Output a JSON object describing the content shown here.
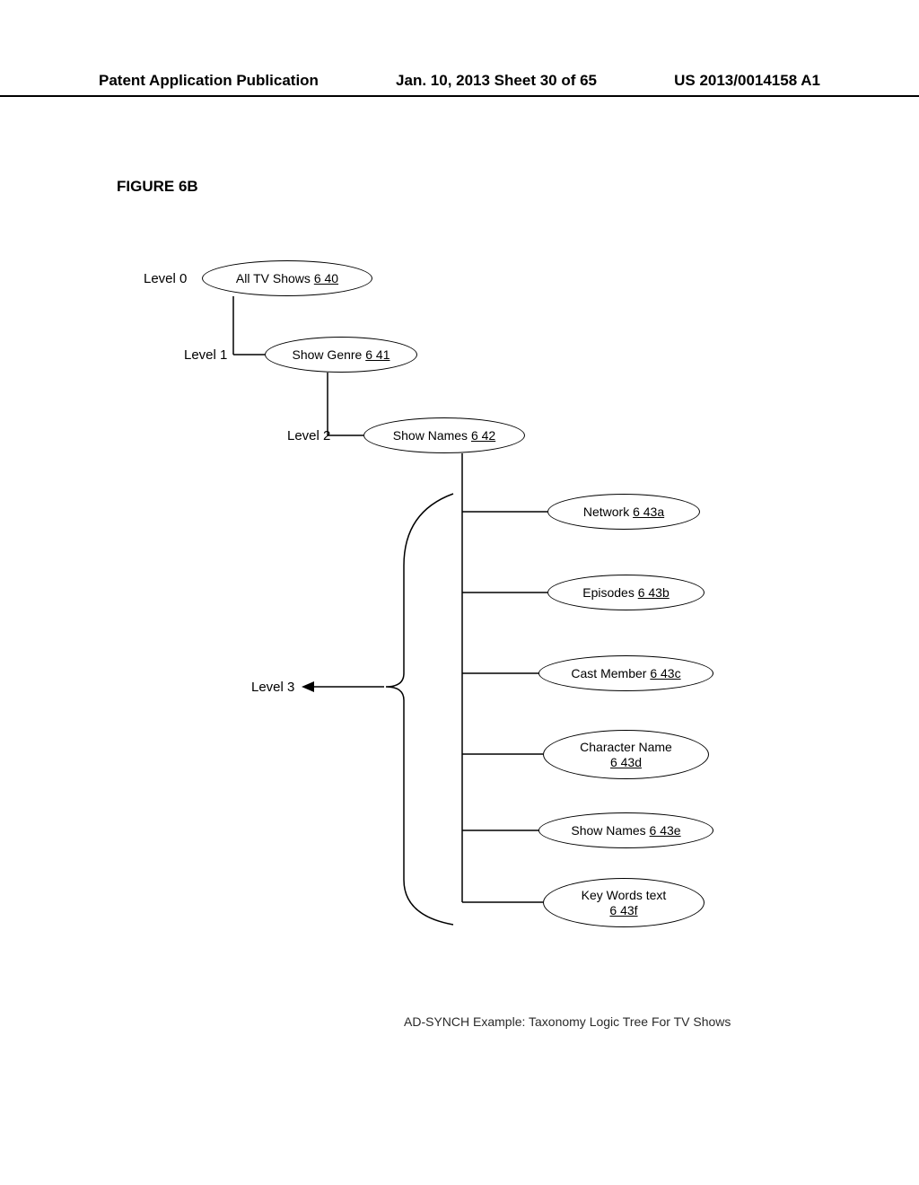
{
  "header": {
    "left": "Patent Application Publication",
    "center": "Jan. 10, 2013  Sheet 30 of 65",
    "right": "US 2013/0014158 A1"
  },
  "figure_label": "FIGURE 6B",
  "levels": {
    "l0": "Level 0",
    "l1": "Level 1",
    "l2": "Level 2",
    "l3": "Level 3"
  },
  "nodes": {
    "root": {
      "text": "All TV Shows",
      "ref": "6 40"
    },
    "genre": {
      "text": "Show Genre",
      "ref": "6 41"
    },
    "names": {
      "text": "Show Names",
      "ref": "6 42"
    },
    "net": {
      "text": "Network",
      "ref": "6 43a"
    },
    "eps": {
      "text": "Episodes",
      "ref": "6 43b"
    },
    "cast": {
      "text": "Cast Member",
      "ref": "6 43c"
    },
    "char": {
      "text": "Character Name",
      "ref": "6 43d"
    },
    "names2": {
      "text": "Show Names",
      "ref": "6 43e"
    },
    "keyw": {
      "text": "Key Words text",
      "ref": "6 43f"
    }
  },
  "caption": "AD-SYNCH Example: Taxonomy Logic Tree For TV Shows"
}
